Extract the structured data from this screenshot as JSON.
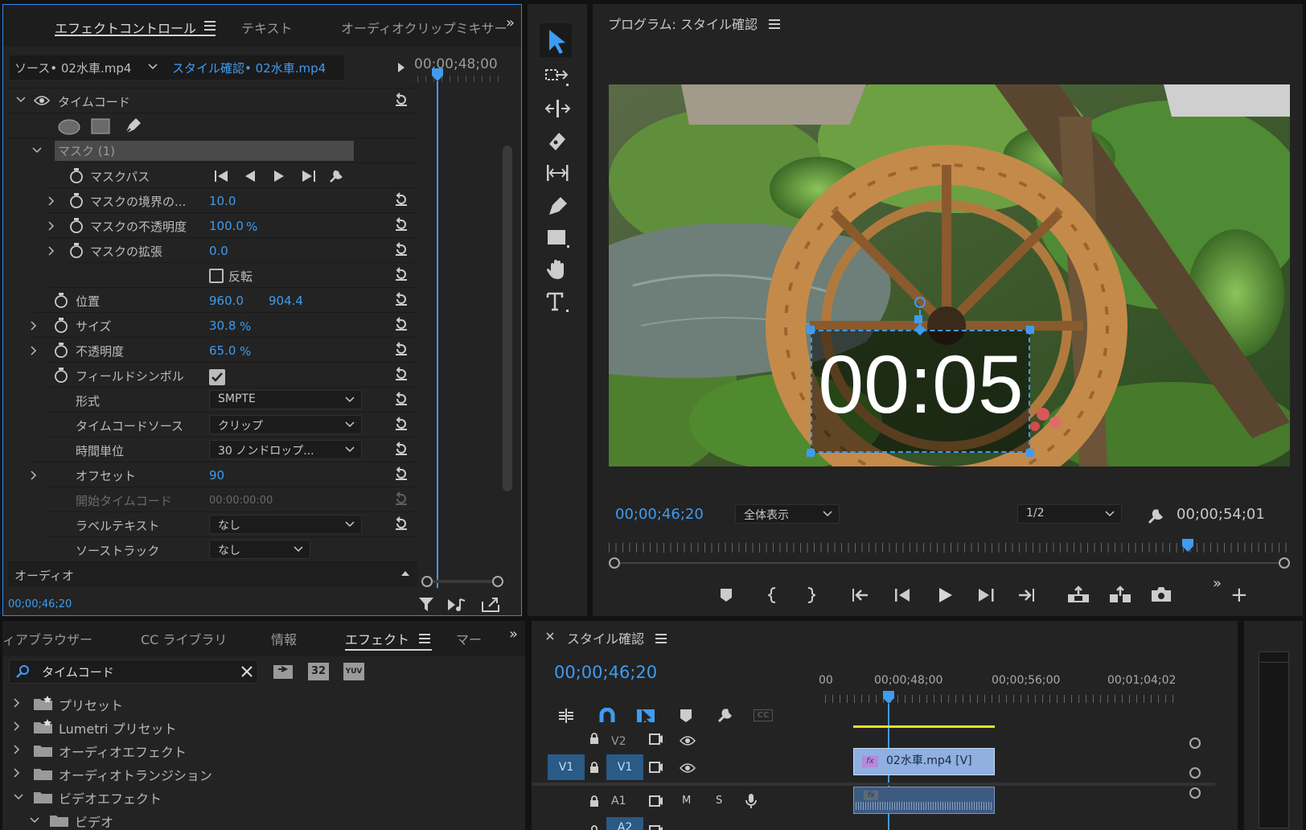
{
  "effect_panel": {
    "tabs": [
      {
        "label": "エフェクトコントロール",
        "active": true
      },
      {
        "label": "テキスト",
        "active": false
      },
      {
        "label": "オーディオクリップミキサー",
        "active": false
      }
    ],
    "source_label": "ソース• 02水車.mp4",
    "sequence_label": "スタイル確認• 02水車.mp4",
    "ruler_time": "00;00;48;00",
    "section": "タイムコード",
    "mask_label": "マスク (1)",
    "props": {
      "mask_path": "マスクパス",
      "mask_feather": {
        "label": "マスクの境界の...",
        "value": "10.0"
      },
      "mask_opacity": {
        "label": "マスクの不透明度",
        "value": "100.0",
        "unit": "%"
      },
      "mask_expansion": {
        "label": "マスクの拡張",
        "value": "0.0"
      },
      "invert": "反転",
      "position": {
        "label": "位置",
        "x": "960.0",
        "y": "904.4"
      },
      "size": {
        "label": "サイズ",
        "value": "30.8",
        "unit": "%"
      },
      "opacity": {
        "label": "不透明度",
        "value": "65.0",
        "unit": "%"
      },
      "field_symbol": "フィールドシンボル",
      "format": {
        "label": "形式",
        "value": "SMPTE"
      },
      "timecode_source": {
        "label": "タイムコードソース",
        "value": "クリップ"
      },
      "time_unit": {
        "label": "時間単位",
        "value": "30 ノンドロップ..."
      },
      "offset": {
        "label": "オフセット",
        "value": "90"
      },
      "start_timecode": {
        "label": "開始タイムコード",
        "value": "00:00:00:00"
      },
      "label_text": {
        "label": "ラベルテキスト",
        "value": "なし"
      },
      "source_track": {
        "label": "ソーストラック",
        "value": "なし"
      }
    },
    "audio_label": "オーディオ",
    "footer_time": "00;00;46;20"
  },
  "program_panel": {
    "title": "プログラム: スタイル確認",
    "overlay_timecode": "00:05",
    "current_time": "00;00;46;20",
    "zoom": "全体表示",
    "resolution": "1/2",
    "duration": "00;00;54;01",
    "playhead_fraction": 0.85
  },
  "effects_panel": {
    "tabs": [
      {
        "label": "ィアブラウザー",
        "active": false
      },
      {
        "label": "CC ライブラリ",
        "active": false
      },
      {
        "label": "情報",
        "active": false
      },
      {
        "label": "エフェクト",
        "active": true
      },
      {
        "label": "マー",
        "active": false
      }
    ],
    "search_value": "タイムコード",
    "badge_32": "32",
    "badge_yuv": "YUV",
    "tree": [
      {
        "label": "プリセット",
        "icon": "preset-folder-icon",
        "expanded": false,
        "depth": 0
      },
      {
        "label": "Lumetri プリセット",
        "icon": "preset-folder-icon",
        "expanded": false,
        "depth": 0
      },
      {
        "label": "オーディオエフェクト",
        "icon": "folder-icon",
        "expanded": false,
        "depth": 0
      },
      {
        "label": "オーディオトランジション",
        "icon": "folder-icon",
        "expanded": false,
        "depth": 0
      },
      {
        "label": "ビデオエフェクト",
        "icon": "folder-icon",
        "expanded": true,
        "depth": 0
      },
      {
        "label": "ビデオ",
        "icon": "folder-icon",
        "expanded": true,
        "depth": 1
      }
    ]
  },
  "timeline_panel": {
    "title": "スタイル確認",
    "current_time": "00;00;46;20",
    "ruler_labels": [
      "00",
      "00;00;48;00",
      "00;00;56;00",
      "00;01;04;02"
    ],
    "tracks": {
      "v2": "V2",
      "v1_source": "V1",
      "v1": "V1",
      "a1": "A1",
      "a2": "A2",
      "mute": "M",
      "solo": "S"
    },
    "clip_label": "02水車.mp4 [V]",
    "fx_badge": "fx"
  },
  "colors": {
    "accent": "#3e9cf0",
    "panel_bg": "#232323",
    "clip_video": "#8fb0e0",
    "clip_audio": "#3d5a80",
    "work_area": "#e8e026"
  }
}
